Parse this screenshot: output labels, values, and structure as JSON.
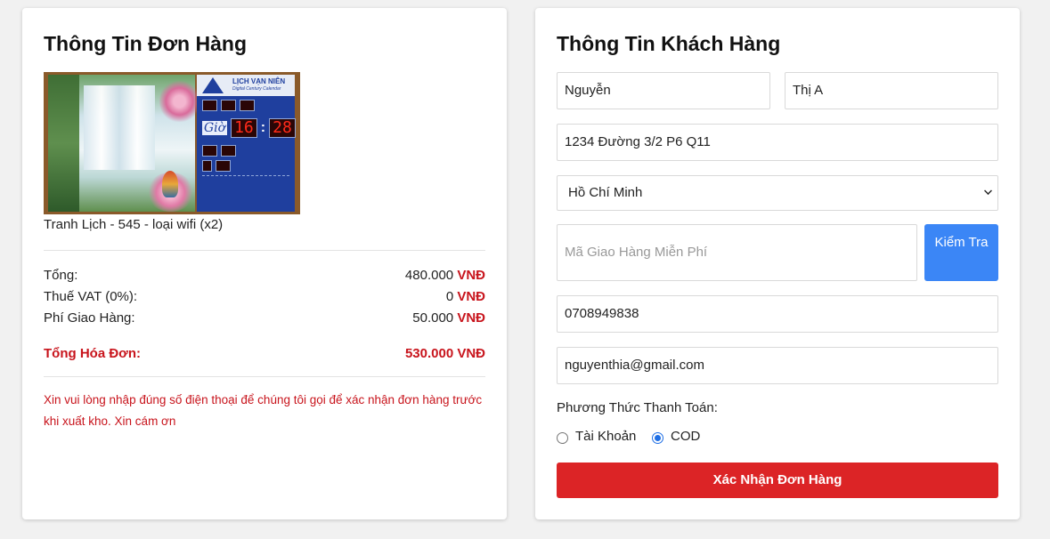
{
  "order": {
    "title": "Thông Tin Đơn Hàng",
    "product": {
      "name": "Tranh Lịch - 545 - loại wifi (x2)",
      "calendar_title": "LỊCH VẠN NIÊN",
      "calendar_subtitle": "Digital Century Calendar",
      "calendar_time_label": "Giờ",
      "calendar_hour": "16",
      "calendar_minute": "28"
    },
    "summary": {
      "subtotal_label": "Tổng:",
      "subtotal_value": "480.000",
      "vat_label": "Thuế VAT (0%):",
      "vat_value": "0",
      "shipping_label": "Phí Giao Hàng:",
      "shipping_value": "50.000",
      "currency": "VNĐ",
      "total_label": "Tổng Hóa Đơn:",
      "total_value": "530.000 VNĐ"
    },
    "note": "Xin vui lòng nhập đúng số điện thoại để chúng tôi gọi để xác nhận đơn hàng trước khi xuất kho. Xin cám ơn"
  },
  "customer": {
    "title": "Thông Tin Khách Hàng",
    "last_name": "Nguyễn",
    "first_name": "Thị A",
    "address": "1234 Đường 3/2 P6 Q11",
    "city": "Hồ Chí Minh",
    "promo_placeholder": "Mã Giao Hàng Miễn Phí",
    "check_button": "Kiểm Tra",
    "phone": "0708949838",
    "email": "nguyenthia@gmail.com",
    "payment_label": "Phương Thức Thanh Toán:",
    "payment_options": [
      "Tài Khoản",
      "COD"
    ],
    "payment_selected": "COD",
    "confirm_button": "Xác Nhận Đơn Hàng"
  },
  "colors": {
    "accent_red": "#dc2426",
    "accent_blue": "#3b86f6"
  }
}
